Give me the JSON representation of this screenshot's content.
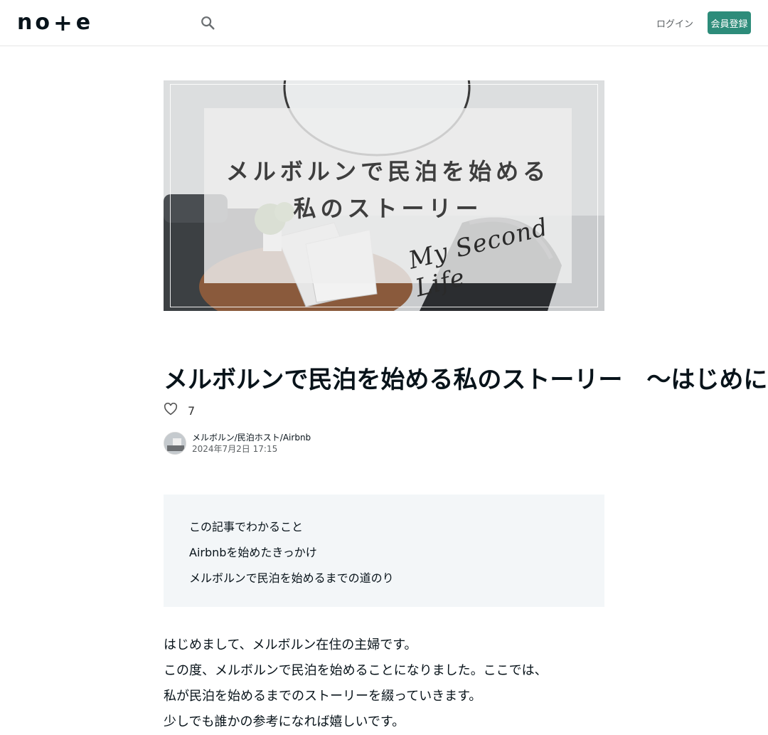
{
  "header": {
    "logo_text": [
      "n",
      "o",
      "+",
      "e"
    ],
    "search_icon": "search-icon",
    "login_label": "ログイン",
    "signup_label": "会員登録"
  },
  "hero": {
    "line1": "メルボルンで民泊を始める",
    "line2": "私のストーリー",
    "script": "My Second Life"
  },
  "article": {
    "title": "メルボルンで民泊を始める私のストーリー　〜はじめに〜",
    "like_icon": "heart-icon",
    "like_count": "7",
    "author_name": "メルボルン/民泊ホスト/Airbnb",
    "date": "2024年7月2日 17:15"
  },
  "summary": {
    "lines": [
      "この記事でわかること",
      "Airbnbを始めたきっかけ",
      "メルボルンで民泊を始めるまでの道のり"
    ]
  },
  "body": {
    "lines": [
      "はじめまして、メルボルン在住の主婦です。",
      "この度、メルボルンで民泊を始めることになりました。ここでは、",
      "私が民泊を始めるまでのストーリーを綴っていきます。",
      "少しでも誰かの参考になれば嬉しいです。"
    ]
  },
  "colors": {
    "accent": "#2d8c7a",
    "summary_bg": "#f3f6f8",
    "text": "#08131a"
  }
}
